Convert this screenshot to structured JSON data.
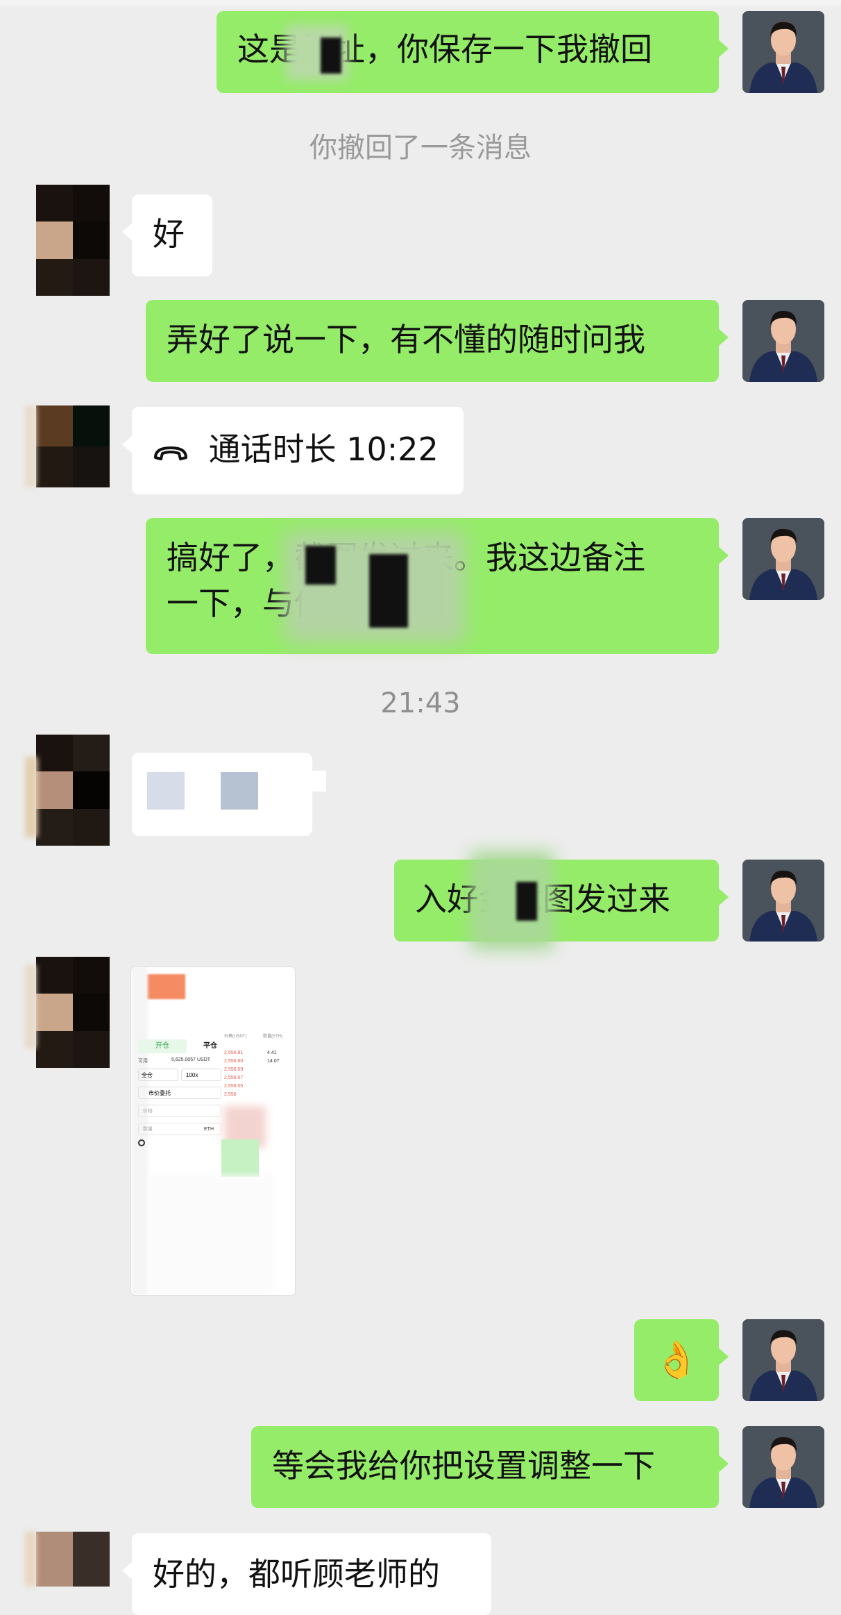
{
  "messages": {
    "m1": "这是地址，你保存一下我撤回",
    "recall_notice": "你撤回了一条消息",
    "m2": "好",
    "m3": "弄好了说一下，有不懂的随时问我",
    "call_label": "通话时长 10:22",
    "m5_line1": "搞好了，截图发过来。我这边备注",
    "m5_line2": "一下，与你同步",
    "time_divider": "21:43",
    "m7": "入好金截图发过来",
    "m9_emoji": "👌",
    "m10": "等会我给你把设置调整一下",
    "m11": "好的，都听顾老师的"
  },
  "trade_screenshot": {
    "tab_open": "开仓",
    "tab_close": "平仓",
    "available_label": "可用",
    "available_value": "5,625.0057 USDT",
    "margin_mode": "全仓",
    "leverage": "100x",
    "order_type": "市价委托",
    "price_placeholder": "价格",
    "qty_placeholder": "数量",
    "qty_unit": "ETH",
    "col_price": "价格(USDT)",
    "col_qty": "数量(ETH)",
    "asks": [
      "2,556.81",
      "2,556.60",
      "2,556.09",
      "2,556.07",
      "2,556.05",
      "2,556"
    ],
    "ask_qty": [
      "4.41",
      "14.07"
    ]
  },
  "colors": {
    "background": "#ededed",
    "my_bubble": "#95ec69",
    "their_bubble": "#ffffff",
    "ask_red": "#e45a4e"
  }
}
